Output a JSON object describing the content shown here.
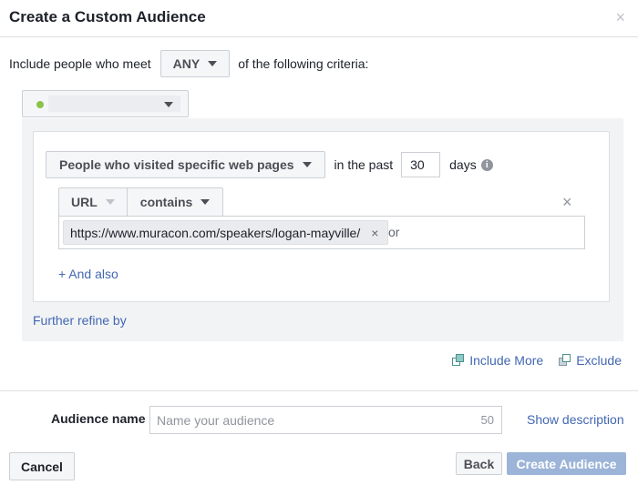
{
  "dialog": {
    "title": "Create a Custom Audience",
    "close_symbol": "×"
  },
  "criteria": {
    "prefix": "Include people who meet",
    "match_mode": "ANY",
    "suffix": "of the following criteria:"
  },
  "pixel_selector": {
    "status_color": "#8bc34a"
  },
  "rule": {
    "event_type": "People who visited specific web pages",
    "timeframe_prefix": "in the past",
    "days_value": "30",
    "days_label": "days",
    "info_symbol": "i",
    "field": "URL",
    "operator": "contains",
    "remove_symbol": "×",
    "url_token": "https://www.muracon.com/speakers/logan-mayville/",
    "token_remove_symbol": "×",
    "or_label": "or",
    "and_also": "+ And also"
  },
  "further_refine": "Further refine by",
  "actions": {
    "include_more": "Include More",
    "exclude": "Exclude"
  },
  "audience_name": {
    "label": "Audience name",
    "placeholder": "Name your audience",
    "char_limit": "50",
    "show_description": "Show description"
  },
  "footer": {
    "cancel": "Cancel",
    "back": "Back",
    "create": "Create Audience"
  },
  "colors": {
    "link": "#4267b2",
    "primary_disabled": "#9cb4d8"
  }
}
